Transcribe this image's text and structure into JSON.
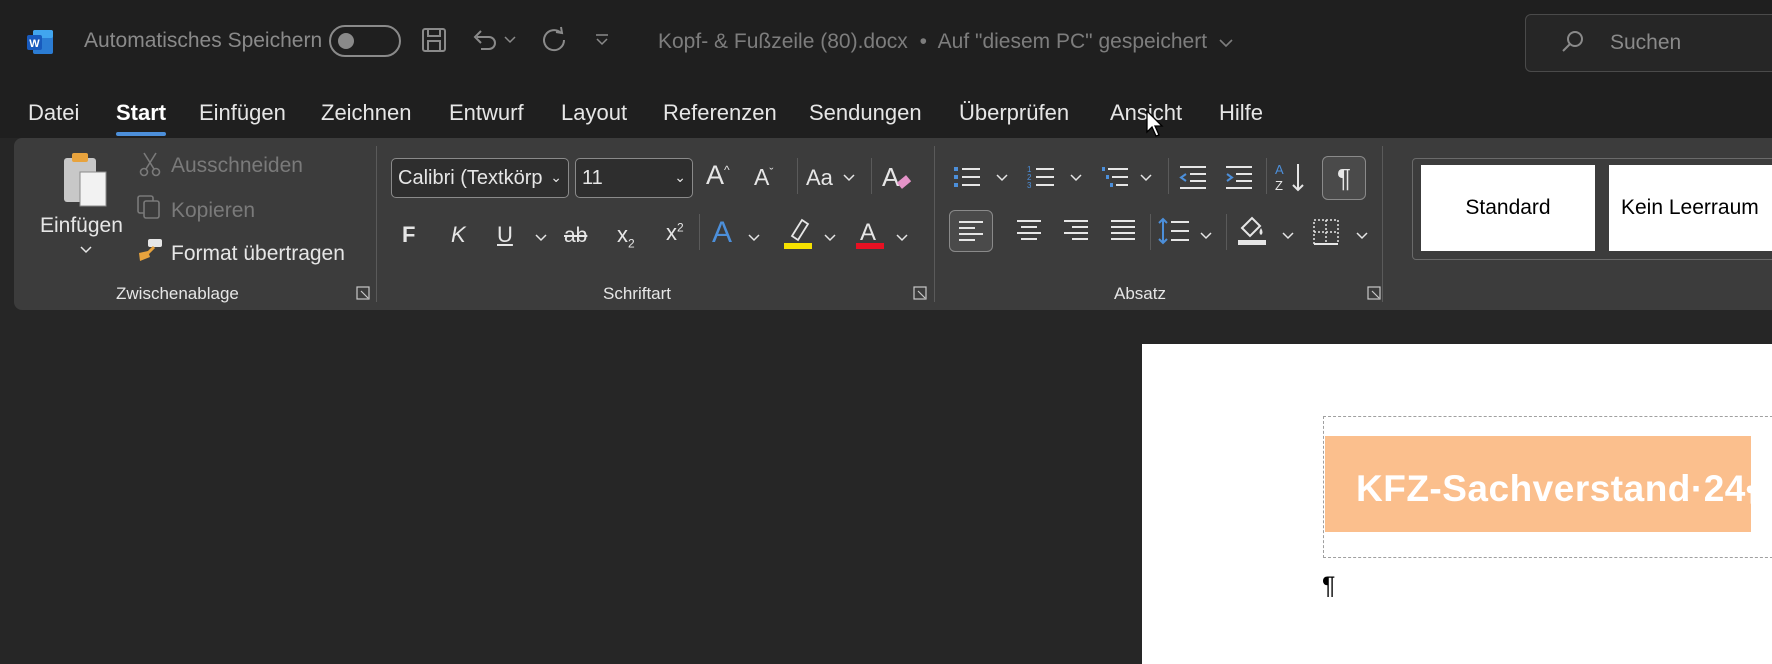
{
  "titlebar": {
    "app_logo": "W",
    "autosave_label": "Automatisches Speichern",
    "document_title": "Kopf- & Fußzeile (80).docx",
    "separator": "•",
    "save_location": "Auf \"diesem PC\" gespeichert",
    "search_placeholder": "Suchen"
  },
  "tabs": [
    {
      "label": "Datei"
    },
    {
      "label": "Start"
    },
    {
      "label": "Einfügen"
    },
    {
      "label": "Zeichnen"
    },
    {
      "label": "Entwurf"
    },
    {
      "label": "Layout"
    },
    {
      "label": "Referenzen"
    },
    {
      "label": "Sendungen"
    },
    {
      "label": "Überprüfen"
    },
    {
      "label": "Ansicht"
    },
    {
      "label": "Hilfe"
    }
  ],
  "ribbon": {
    "clipboard": {
      "paste_label": "Einfügen",
      "cut_label": "Ausschneiden",
      "copy_label": "Kopieren",
      "format_painter_label": "Format übertragen",
      "group_label": "Zwischenablage"
    },
    "font": {
      "font_name": "Calibri (Textkörp",
      "font_size": "11",
      "case_label": "Aa",
      "bold": "F",
      "italic": "K",
      "underline": "U",
      "strike": "ab",
      "group_label": "Schriftart",
      "highlight_color": "#f5e100",
      "font_color": "#e81123"
    },
    "paragraph": {
      "group_label": "Absatz"
    },
    "styles": {
      "items": [
        "Standard",
        "Kein Leerraum"
      ]
    }
  },
  "document": {
    "header_text": "KFZ-Sachverstand·24",
    "header_pilcrow": "¶",
    "body_pilcrow": "¶",
    "header_fill": "#fbbf8d"
  },
  "colors": {
    "accent": "#4c8fda",
    "word_blue": "#185abd"
  }
}
